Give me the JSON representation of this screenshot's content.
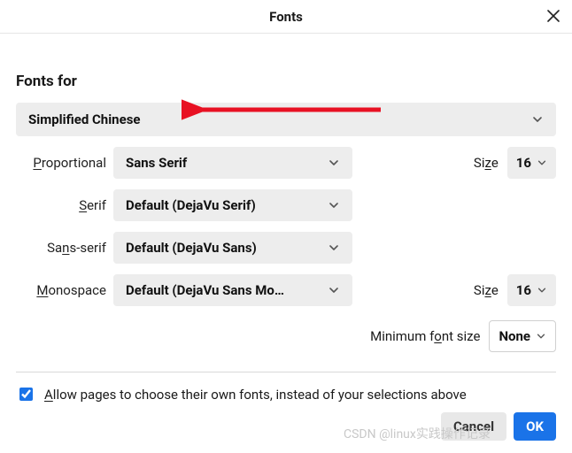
{
  "header": {
    "title": "Fonts"
  },
  "sectionTitle": "Fonts for",
  "fontsFor": {
    "value": "Simplified Chinese"
  },
  "labels": {
    "proportional_pre": "P",
    "proportional_post": "roportional",
    "serif_pre": "S",
    "serif_post": "erif",
    "sans_pre": "Sa",
    "sans_mid": "n",
    "sans_post": "s-serif",
    "mono_pre": "M",
    "mono_post": "onospace",
    "size_pre": "Si",
    "size_mid": "z",
    "size_post": "e",
    "minfont_pre": "Minimum f",
    "minfont_mid": "o",
    "minfont_post": "nt size",
    "allow_pre": "A",
    "allow_post": "llow pages to choose their own fonts, instead of your selections above"
  },
  "values": {
    "proportional": "Sans Serif",
    "serif": "Default (DejaVu Serif)",
    "sans": "Default (DejaVu Sans)",
    "mono": "Default (DejaVu Sans Mo…",
    "size1": "16",
    "size2": "16",
    "minfont": "None"
  },
  "allowChecked": true,
  "buttons": {
    "cancel": "Cancel",
    "ok": "OK"
  },
  "watermark": "CSDN @linux实践操作记录"
}
